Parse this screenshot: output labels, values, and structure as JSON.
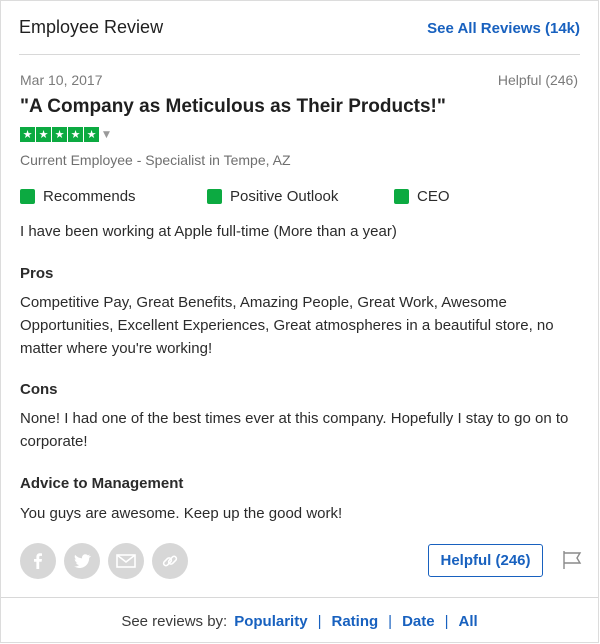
{
  "header": {
    "title": "Employee Review",
    "see_all": "See All Reviews (14k)"
  },
  "review": {
    "date": "Mar 10, 2017",
    "helpful_count": "Helpful (246)",
    "title": "\"A Company as Meticulous as Their Products!\"",
    "rating": 5,
    "rating_max": 5,
    "author": "Current Employee - Specialist in Tempe, AZ",
    "indicators": [
      "Recommends",
      "Positive Outlook",
      "CEO"
    ],
    "employment": "I have been working at Apple full-time (More than a year)",
    "pros_heading": "Pros",
    "pros": "Competitive Pay, Great Benefits, Amazing People, Great Work, Awesome Opportunities, Excellent Experiences, Great atmospheres in a beautiful store, no matter where you're working!",
    "cons_heading": "Cons",
    "cons": "None! I had one of the best times ever at this company. Hopefully I stay to go on to corporate!",
    "advice_heading": "Advice to Management",
    "advice": "You guys are awesome. Keep up the good work!"
  },
  "actions": {
    "helpful_button": "Helpful (246)",
    "share_icons": [
      "facebook-icon",
      "twitter-icon",
      "email-icon",
      "link-icon"
    ],
    "flag_icon": "flag-icon"
  },
  "footer": {
    "label": "See reviews by:",
    "links": [
      "Popularity",
      "Rating",
      "Date",
      "All"
    ],
    "separator": "|"
  },
  "colors": {
    "accent": "#1861bf",
    "rating_green": "#0caa41",
    "muted": "#7a7a7a",
    "icon_bg": "#d7d7d7"
  }
}
